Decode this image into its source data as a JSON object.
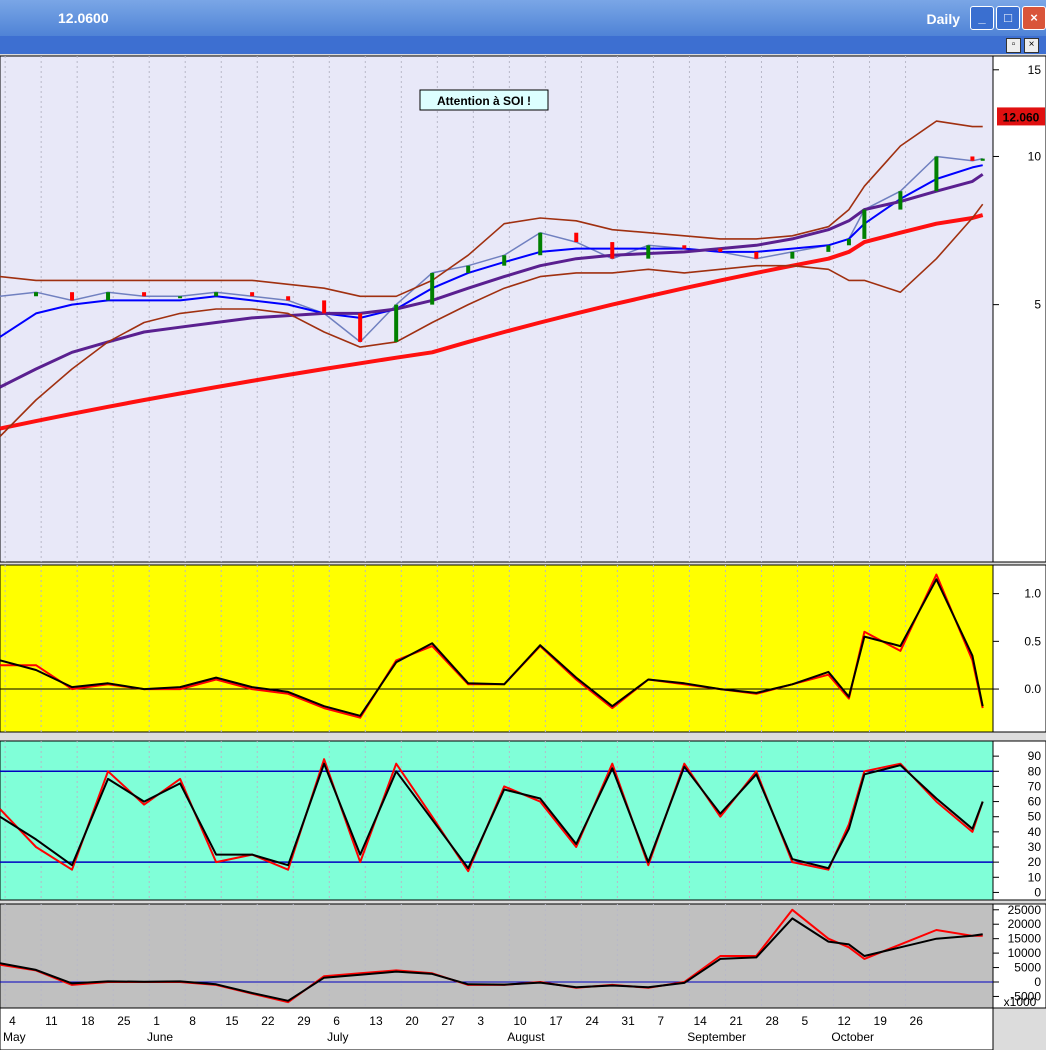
{
  "window": {
    "title": "12.0600",
    "period": "Daily",
    "min_icon": "minimize-icon",
    "max_icon": "maximize-icon",
    "close_icon": "close-icon"
  },
  "colors": {
    "price_bg": "#e8e8f8",
    "osc_bg": "#ffff00",
    "stoch_bg": "#80ffd8",
    "vol_bg": "#c0c0c0",
    "ma_fast": "#0000ff",
    "ma_mid": "#5a2090",
    "ma_slow": "#ff1010",
    "bands": "#a03010",
    "signal": "#ff0000",
    "main": "#000000",
    "up": "#008000",
    "down": "#ff0000"
  },
  "chart_data": [
    {
      "type": "line",
      "panel": "price",
      "annotation": "Attention à SOI !",
      "last_value_label": "12.060",
      "y_ticks": [
        15,
        10,
        5
      ],
      "ylim": [
        1.5,
        16
      ],
      "log_scale": true,
      "x": [
        0,
        7,
        14,
        21,
        28,
        35,
        42,
        49,
        56,
        63,
        70,
        77,
        84,
        91,
        98,
        105,
        112,
        119,
        126,
        133,
        140,
        147,
        154,
        161,
        165,
        168,
        175,
        182,
        189,
        191
      ],
      "series": [
        {
          "values": [
            5.2,
            5.3,
            5.1,
            5.3,
            5.2,
            5.2,
            5.3,
            5.2,
            5.1,
            4.8,
            4.2,
            5.0,
            5.8,
            6.0,
            6.3,
            7.0,
            6.7,
            6.2,
            6.6,
            6.5,
            6.4,
            6.2,
            6.4,
            6.6,
            6.8,
            7.8,
            8.5,
            10.0,
            9.8,
            9.9
          ]
        },
        {
          "values": [
            4.3,
            4.8,
            5.0,
            5.1,
            5.1,
            5.1,
            5.2,
            5.1,
            5.0,
            4.8,
            4.7,
            4.9,
            5.4,
            5.8,
            6.1,
            6.4,
            6.5,
            6.5,
            6.5,
            6.5,
            6.4,
            6.4,
            6.5,
            6.6,
            6.8,
            7.3,
            8.2,
            9.0,
            9.5,
            9.6
          ]
        },
        {
          "values": [
            3.4,
            3.7,
            4.0,
            4.2,
            4.4,
            4.5,
            4.6,
            4.7,
            4.75,
            4.8,
            4.8,
            4.9,
            5.1,
            5.4,
            5.7,
            6.0,
            6.2,
            6.3,
            6.35,
            6.4,
            6.5,
            6.6,
            6.8,
            7.1,
            7.4,
            7.8,
            8.1,
            8.5,
            8.9,
            9.2
          ]
        },
        {
          "values": [
            2.8,
            2.9,
            3.0,
            3.1,
            3.2,
            3.3,
            3.4,
            3.5,
            3.6,
            3.7,
            3.8,
            3.9,
            4.0,
            4.2,
            4.4,
            4.6,
            4.8,
            5.0,
            5.2,
            5.4,
            5.6,
            5.8,
            6.0,
            6.2,
            6.4,
            6.7,
            7.0,
            7.3,
            7.5,
            7.6
          ]
        },
        {
          "values": [
            5.7,
            5.6,
            5.6,
            5.6,
            5.6,
            5.6,
            5.6,
            5.6,
            5.5,
            5.4,
            5.2,
            5.2,
            5.6,
            6.3,
            7.3,
            7.5,
            7.4,
            7.1,
            7.0,
            6.9,
            6.8,
            6.8,
            6.9,
            7.2,
            7.8,
            8.7,
            10.5,
            11.8,
            11.5,
            11.5
          ]
        },
        {
          "values": [
            2.7,
            3.2,
            3.7,
            4.2,
            4.6,
            4.8,
            4.9,
            4.9,
            4.8,
            4.4,
            4.1,
            4.2,
            4.6,
            5.0,
            5.4,
            5.7,
            5.8,
            5.8,
            5.9,
            5.8,
            5.9,
            6.0,
            6.0,
            5.9,
            5.6,
            5.6,
            5.3,
            6.2,
            7.5,
            8.0
          ]
        }
      ],
      "x_date_labels": [
        "4",
        "11",
        "18",
        "25",
        "1",
        "8",
        "15",
        "22",
        "29",
        "6",
        "13",
        "20",
        "27",
        "3",
        "10",
        "17",
        "24",
        "31",
        "7",
        "14",
        "21",
        "28",
        "5",
        "12",
        "19",
        "26"
      ],
      "month_labels": [
        "May",
        "June",
        "July",
        "August",
        "September",
        "October"
      ]
    },
    {
      "type": "line",
      "panel": "oscillator",
      "y_ticks": [
        1.0,
        0.5,
        0.0
      ],
      "ylim": [
        -0.45,
        1.3
      ],
      "x": [
        0,
        7,
        14,
        21,
        28,
        35,
        42,
        49,
        56,
        63,
        70,
        77,
        84,
        91,
        98,
        105,
        112,
        119,
        126,
        133,
        140,
        147,
        154,
        161,
        165,
        168,
        175,
        182,
        189,
        191
      ],
      "series": [
        {
          "values": [
            0.25,
            0.25,
            0.0,
            0.05,
            0.0,
            0.0,
            0.1,
            0.0,
            -0.05,
            -0.2,
            -0.3,
            0.3,
            0.45,
            0.05,
            0.05,
            0.45,
            0.1,
            -0.2,
            0.1,
            0.05,
            0.0,
            -0.05,
            0.05,
            0.15,
            -0.1,
            0.6,
            0.4,
            1.2,
            0.3,
            -0.2
          ]
        },
        {
          "values": [
            0.3,
            0.2,
            0.02,
            0.06,
            0.0,
            0.02,
            0.12,
            0.02,
            -0.03,
            -0.18,
            -0.28,
            0.28,
            0.48,
            0.06,
            0.05,
            0.46,
            0.12,
            -0.18,
            0.1,
            0.06,
            0.0,
            -0.04,
            0.05,
            0.18,
            -0.08,
            0.55,
            0.45,
            1.15,
            0.35,
            -0.18
          ]
        }
      ]
    },
    {
      "type": "line",
      "panel": "stochastic",
      "y_ticks": [
        90,
        80,
        70,
        60,
        50,
        40,
        30,
        20,
        10,
        0
      ],
      "ylim": [
        -5,
        100
      ],
      "reference_lines": [
        80,
        20
      ],
      "x": [
        0,
        7,
        14,
        21,
        28,
        35,
        42,
        49,
        56,
        63,
        70,
        77,
        84,
        91,
        98,
        105,
        112,
        119,
        126,
        133,
        140,
        147,
        154,
        161,
        165,
        168,
        175,
        182,
        189,
        191
      ],
      "series": [
        {
          "values": [
            55,
            30,
            15,
            80,
            58,
            75,
            20,
            25,
            15,
            88,
            20,
            85,
            50,
            14,
            70,
            60,
            30,
            85,
            18,
            85,
            50,
            80,
            20,
            15,
            45,
            80,
            85,
            60,
            40,
            60
          ]
        },
        {
          "values": [
            50,
            35,
            18,
            75,
            60,
            72,
            25,
            25,
            18,
            85,
            25,
            80,
            48,
            16,
            68,
            62,
            32,
            82,
            20,
            83,
            52,
            78,
            22,
            16,
            42,
            78,
            84,
            62,
            42,
            60
          ]
        }
      ]
    },
    {
      "type": "line",
      "panel": "volume_indicator",
      "y_unit_label": "x1000",
      "y_ticks": [
        25000,
        20000,
        15000,
        10000,
        5000,
        0,
        -5000
      ],
      "ylim": [
        -9000,
        27000
      ],
      "x": [
        0,
        7,
        14,
        21,
        28,
        35,
        42,
        49,
        56,
        63,
        70,
        77,
        84,
        91,
        98,
        105,
        112,
        119,
        126,
        133,
        140,
        147,
        154,
        161,
        165,
        168,
        175,
        182,
        189,
        191
      ],
      "series": [
        {
          "values": [
            6000,
            4000,
            -1000,
            0,
            0,
            0,
            -1000,
            -4000,
            -7000,
            2000,
            3000,
            4000,
            3000,
            -1000,
            -1000,
            0,
            -2000,
            -1000,
            -2000,
            0,
            9000,
            9000,
            25000,
            15000,
            12000,
            8000,
            13000,
            18000,
            16000,
            16000
          ]
        },
        {
          "values": [
            6500,
            4200,
            -500,
            200,
            100,
            200,
            -800,
            -3800,
            -6500,
            1500,
            2500,
            3600,
            2800,
            -800,
            -900,
            -200,
            -1800,
            -1200,
            -1800,
            -300,
            8000,
            8500,
            22000,
            14000,
            13000,
            9000,
            12000,
            15000,
            16000,
            16500
          ]
        }
      ]
    }
  ]
}
